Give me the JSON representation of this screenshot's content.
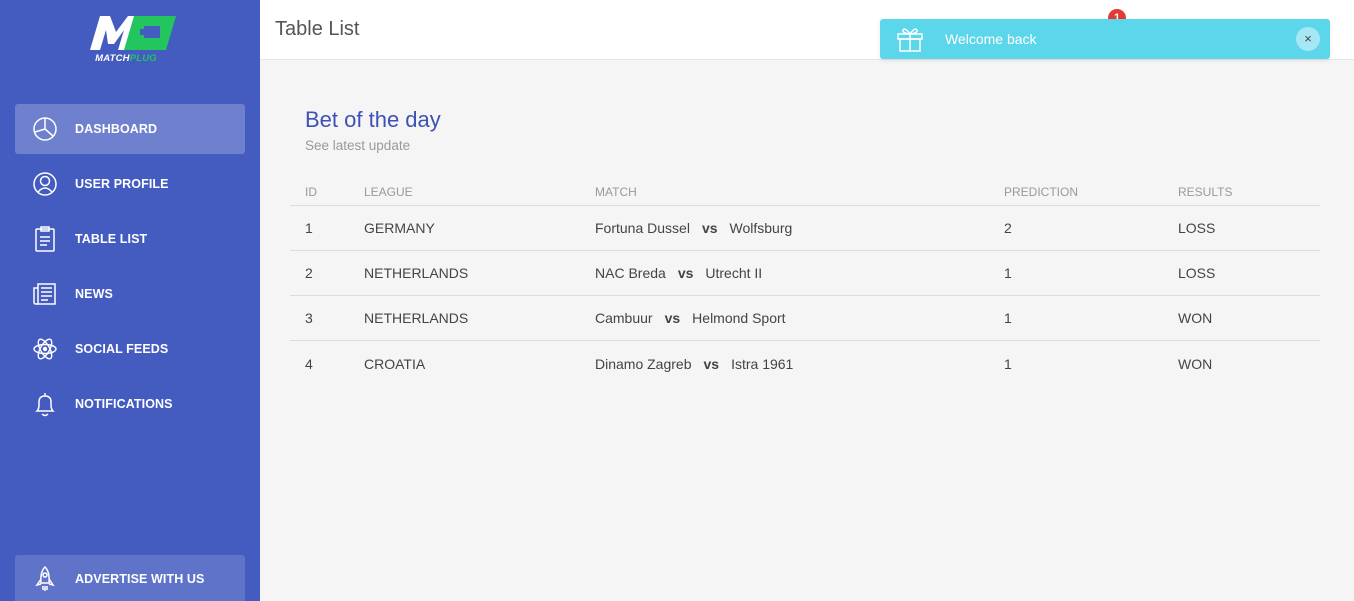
{
  "brand": {
    "logo_letters": "M",
    "name_part1": "MATCH",
    "name_part2": "PLUG",
    "accent_color": "#22c55e"
  },
  "sidebar": {
    "bg_color": "#445cc0",
    "items": [
      {
        "label": "DASHBOARD",
        "icon": "chart-pie-icon",
        "active": true
      },
      {
        "label": "USER PROFILE",
        "icon": "user-icon",
        "active": false
      },
      {
        "label": "TABLE LIST",
        "icon": "clipboard-icon",
        "active": false
      },
      {
        "label": "NEWS",
        "icon": "newspaper-icon",
        "active": false
      },
      {
        "label": "SOCIAL FEEDS",
        "icon": "atom-icon",
        "active": false
      },
      {
        "label": "NOTIFICATIONS",
        "icon": "bell-icon",
        "active": false
      }
    ],
    "advertise_label": "ADVERTISE WITH US",
    "advertise_icon": "rocket-icon"
  },
  "header": {
    "title": "Table List",
    "notification_count": "1"
  },
  "toast": {
    "message": "Welcome back",
    "icon": "gift-icon",
    "close_label": "×",
    "color": "#5cd6ea"
  },
  "card": {
    "title": "Bet of the day",
    "subtitle": "See latest update"
  },
  "table": {
    "headers": {
      "id": "ID",
      "league": "LEAGUE",
      "match": "MATCH",
      "prediction": "PREDICTION",
      "results": "RESULTS"
    },
    "rows": [
      {
        "id": "1",
        "league": "GERMANY",
        "home": "Fortuna Dussel",
        "vs": "vs",
        "away": "Wolfsburg",
        "prediction": "2",
        "result": "LOSS"
      },
      {
        "id": "2",
        "league": "NETHERLANDS",
        "home": "NAC Breda",
        "vs": "vs",
        "away": "Utrecht II",
        "prediction": "1",
        "result": "LOSS"
      },
      {
        "id": "3",
        "league": "NETHERLANDS",
        "home": "Cambuur",
        "vs": "vs",
        "away": "Helmond Sport",
        "prediction": "1",
        "result": "WON"
      },
      {
        "id": "4",
        "league": "CROATIA",
        "home": "Dinamo Zagreb",
        "vs": "vs",
        "away": "Istra 1961",
        "prediction": "1",
        "result": "WON"
      }
    ]
  }
}
